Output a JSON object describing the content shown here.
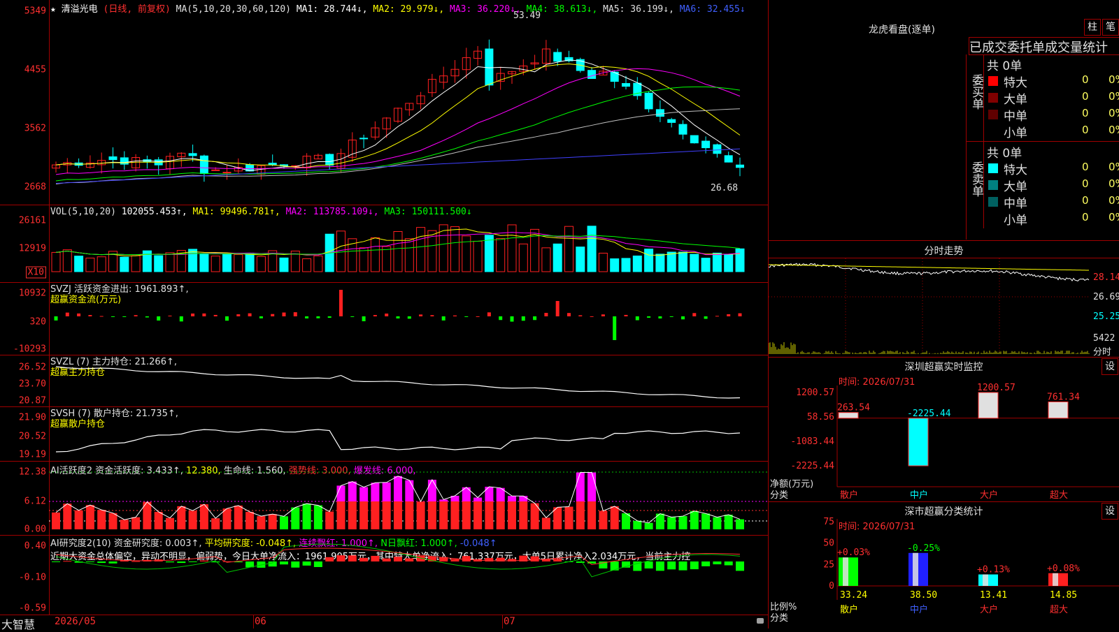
{
  "main": {
    "star": "★",
    "stock_name": "清溢光电",
    "period_mode": "(日线, 前复权)",
    "ma_header": "MA(5,10,20,30,60,120)",
    "ma1": "MA1: 28.744↓,",
    "ma2": "MA2: 29.979↓,",
    "ma3": "MA3: 36.220↓,",
    "ma4": "MA4: 38.613↓,",
    "ma5": "MA5: 36.199↓,",
    "ma6": "MA6: 32.455↓",
    "y_ticks": [
      "5349",
      "4455",
      "3562",
      "2668"
    ],
    "high_label": "53.49",
    "low_label": "26.68"
  },
  "volume": {
    "header": "VOL(5,10,20)",
    "value": "102055.453↑,",
    "ma1": "MA1: 99496.781↑,",
    "ma2": "MA2: 113785.109↓,",
    "ma3": "MA3: 150111.500↓",
    "y_ticks": [
      "26161",
      "12919"
    ],
    "unit": "X10"
  },
  "svzj": {
    "line1": "SVZJ  活跃资金进出: 1961.893↑,",
    "line2": "超赢资金流(万元)",
    "y_ticks": [
      "10932",
      "320",
      "-10293"
    ]
  },
  "svzl": {
    "line1": "SVZL (7) 主力持仓: 21.266↑,",
    "line2": "超赢主力持仓",
    "y_ticks": [
      "26.52",
      "23.70",
      "20.87"
    ]
  },
  "svsh": {
    "line1": "SVSH (7) 散户持仓: 21.735↑,",
    "line2": "超赢散户持仓",
    "y_ticks": [
      "21.90",
      "20.52",
      "19.19"
    ]
  },
  "ai_active": {
    "label_a": "AI活跃度2 资金活跃度: 3.433↑,",
    "label_b": "12.380,",
    "label_c": "生命线: 1.560,",
    "label_d": "强势线: 3.000,",
    "label_e": "爆发线: 6.000,",
    "y_ticks": [
      "12.38",
      "6.12",
      "0.00"
    ]
  },
  "ai_research": {
    "label_a": "AI研究度2(10) 资金研究度: 0.003↑,",
    "label_b": "平均研究度: -0.048↑,",
    "label_c": "连续飘红: 1.000↑,",
    "label_d": "N日飘红: 1.000↑,",
    "label_e": "-0.048↑",
    "summary": "近期大资金总体偏空，异动不明显，偏弱势，今日大单净流入：1961.905万元，其中特大单净流入：761.337万元，大单5日累计净入2.034万元，当前主力控",
    "y_ticks": [
      "0.40",
      "-0.10",
      "-0.59"
    ]
  },
  "xaxis": {
    "brand": "大智慧",
    "dates": [
      "2026/05",
      "06",
      "07"
    ]
  },
  "right": {
    "dragon_title": "龙虎看盘(逐单)",
    "btn_bar": "柱",
    "btn_pen": "笔",
    "tab_label": "已成交委托单成交量统计",
    "buy_side": {
      "label": "委买单",
      "total": "共 0单",
      "rows": [
        {
          "name": "特大",
          "count": "0",
          "pct": "0%",
          "color": "#ff0000"
        },
        {
          "name": "大单",
          "count": "0",
          "pct": "0%",
          "color": "#800000"
        },
        {
          "name": "中单",
          "count": "0",
          "pct": "0%",
          "color": "#600000"
        },
        {
          "name": "小单",
          "count": "0",
          "pct": "0%",
          "color": ""
        }
      ]
    },
    "sell_side": {
      "label": "委卖单",
      "total": "共 0单",
      "rows": [
        {
          "name": "特大",
          "count": "0",
          "pct": "0%",
          "color": "#00ffff"
        },
        {
          "name": "大单",
          "count": "0",
          "pct": "0%",
          "color": "#008080"
        },
        {
          "name": "中单",
          "count": "0",
          "pct": "0%",
          "color": "#006060"
        },
        {
          "name": "小单",
          "count": "0",
          "pct": "0%",
          "color": ""
        }
      ]
    },
    "intraday": {
      "title": "分时走势",
      "ticks": [
        "28.14",
        "26.69",
        "25.25"
      ],
      "vol_tick": "5422",
      "unit": "分时"
    },
    "sz_monitor": {
      "title": "深圳超赢实时监控",
      "set_btn": "设",
      "time": "时间: 2026/07/31",
      "y_ticks": [
        "1200.57",
        "58.56",
        "-1083.44",
        "-2225.44"
      ],
      "axis_label_1": "净额(万元)",
      "axis_label_2": "分类",
      "bars": [
        {
          "name": "散户",
          "value": 263.54
        },
        {
          "name": "中户",
          "value": -2225.44
        },
        {
          "name": "大户",
          "value": 1200.57
        },
        {
          "name": "超大",
          "value": 761.34
        }
      ],
      "bar_labels": [
        "263.54",
        "-2225.44",
        "1200.57",
        "761.34"
      ]
    },
    "sz_class": {
      "title": "深市超赢分类统计",
      "set_btn": "设",
      "time": "时间: 2026/07/31",
      "y_ticks": [
        "75",
        "50",
        "25",
        "0"
      ],
      "axis_label_1": "比例%",
      "axis_label_2": "分类",
      "categories": [
        "散户",
        "中户",
        "大户",
        "超大"
      ],
      "values": [
        33.24,
        38.5,
        13.41,
        14.85
      ],
      "value_labels": [
        "33.24",
        "38.50",
        "13.41",
        "14.85"
      ],
      "changes": [
        "+0.03%",
        "-0.25%",
        "+0.13%",
        "+0.08%"
      ]
    }
  },
  "chart_data": [
    {
      "type": "candlestick",
      "title": "清溢光电 (日线, 前复权)",
      "ylim": [
        26.0,
        54.5
      ],
      "y_ticks": [
        53.49,
        44.55,
        35.62,
        26.68
      ],
      "annotations": {
        "high": 53.49,
        "low": 26.68
      }
    },
    {
      "type": "bar",
      "title": "VOL(5,10,20)",
      "ylim": [
        0,
        26161
      ]
    },
    {
      "type": "bar",
      "title": "深圳超赢实时监控",
      "categories": [
        "散户",
        "中户",
        "大户",
        "超大"
      ],
      "values": [
        263.54,
        -2225.44,
        1200.57,
        761.34
      ],
      "ylim": [
        -2225.44,
        1200.57
      ]
    },
    {
      "type": "bar",
      "title": "深市超赢分类统计",
      "categories": [
        "散户",
        "中户",
        "大户",
        "超大"
      ],
      "values": [
        33.24,
        38.5,
        13.41,
        14.85
      ],
      "ylim": [
        0,
        75
      ]
    }
  ],
  "colors": {
    "up": "#ff2020",
    "down": "#00ffff",
    "ma1": "#ffffff",
    "ma2": "#ffff00",
    "ma3": "#ff00ff",
    "ma4": "#00ff00",
    "ma5": "#c0c0c0",
    "ma6": "#4040ff",
    "grid": "#a00000"
  }
}
